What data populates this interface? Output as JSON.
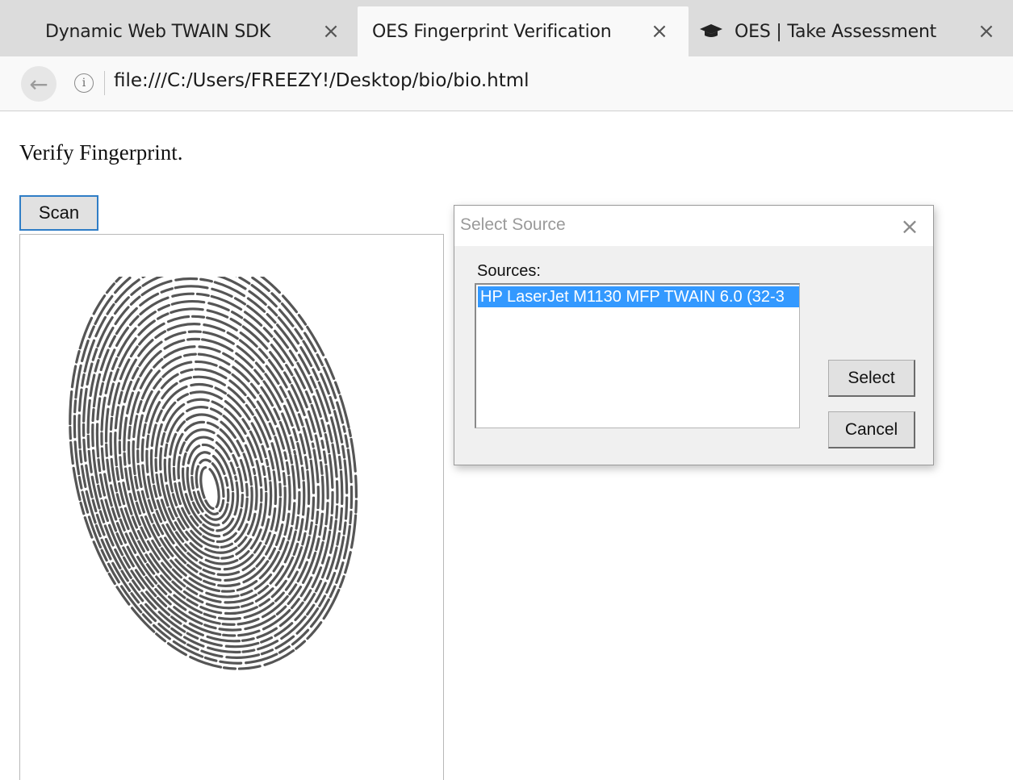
{
  "browser": {
    "tabs": [
      {
        "title": "Dynamic Web TWAIN SDK",
        "active": false
      },
      {
        "title": "OES Fingerprint Verification",
        "active": true
      },
      {
        "title": "OES | Take Assessment",
        "active": false,
        "icon": "graduation-cap-icon"
      }
    ],
    "close_glyph": "×",
    "url": "file:///C:/Users/FREEZY!/Desktop/bio/bio.html"
  },
  "page": {
    "heading": "Verify Fingerprint.",
    "scan_label": "Scan"
  },
  "dialog": {
    "title": "Select Source",
    "sources_label": "Sources:",
    "sources": [
      "HP LaserJet M1130 MFP TWAIN 6.0 (32-3"
    ],
    "selected_index": 0,
    "select_label": "Select",
    "cancel_label": "Cancel"
  },
  "colors": {
    "selection": "#3399ff",
    "focus_border": "#2f7dc6",
    "fingerprint": "#555555"
  }
}
